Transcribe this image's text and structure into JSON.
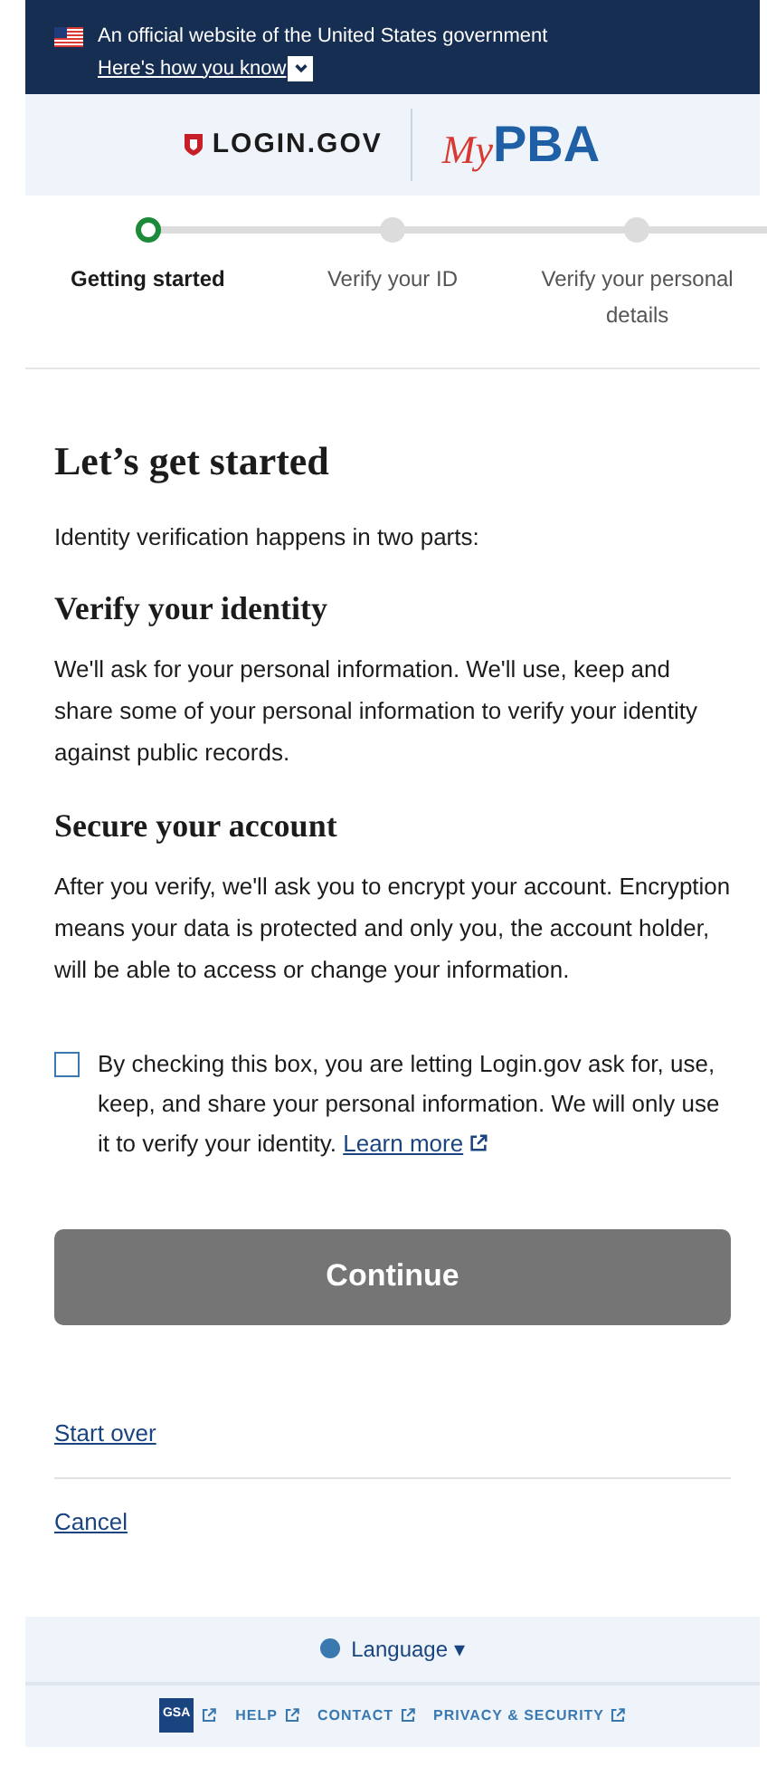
{
  "banner": {
    "text": "An official website of the United States government",
    "link": "Here's how you know",
    "expanded": false
  },
  "header": {
    "login_logo": "LOGIN.GOV",
    "partner_logo_prefix": "My",
    "partner_logo": "PBA"
  },
  "steps": [
    {
      "label": "Getting started",
      "current": true
    },
    {
      "label": "Verify your ID",
      "current": false
    },
    {
      "label": "Verify your personal details",
      "current": false
    }
  ],
  "title": "Let’s get started",
  "intro": "Identity verification happens in two parts:",
  "sections": [
    {
      "heading": "Verify your identity",
      "body": "We'll ask for your personal information. We'll use, keep and share some of your personal information to verify your identity against public records."
    },
    {
      "heading": "Secure your account",
      "body": "After you verify, we'll ask you to encrypt your account. Encryption means your data is protected and only you, the account holder, will be able to access or change your information."
    }
  ],
  "consent": {
    "checked": false,
    "text": "By checking this box, you are letting Login.gov ask for, use, keep, and share your personal information. We will only use it to verify your identity.",
    "link": "Learn more"
  },
  "continue_button": {
    "label": "Continue",
    "disabled": true
  },
  "links": [
    "Start over",
    "Cancel"
  ],
  "footer": {
    "language": "Language ▾",
    "gsa": "GSA",
    "links": [
      "HELP",
      "CONTACT",
      "PRIVACY & SECURITY"
    ]
  }
}
